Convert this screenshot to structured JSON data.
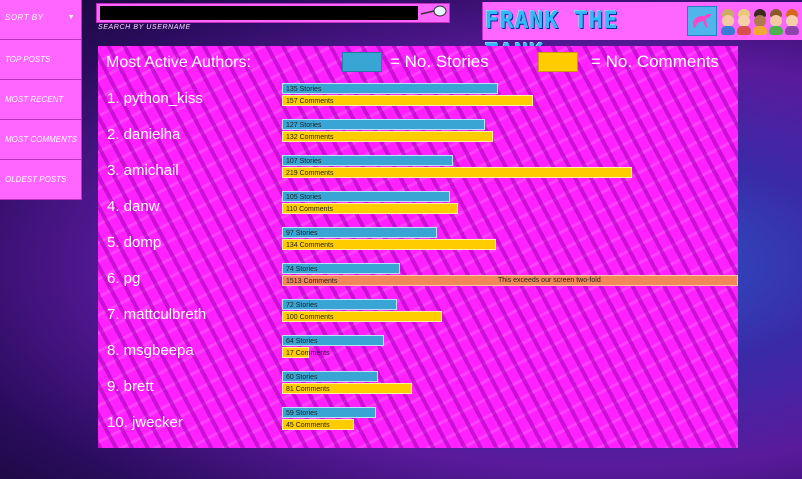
{
  "header": {
    "sort_by_label": "SORT BY",
    "search_placeholder": "",
    "search_caption": "SEARCH BY USERNAME",
    "logo_text": "FRANK THE TANK"
  },
  "menu": [
    {
      "label": "TOP POSTS"
    },
    {
      "label": "MOST RECENT"
    },
    {
      "label": "MOST COMMENTS"
    },
    {
      "label": "OLDEST POSTS"
    }
  ],
  "panel": {
    "title": "Most Active Authors:",
    "legend_stories": "= No. Stories",
    "legend_comments": "= No. Comments",
    "colors": {
      "stories": "#39a5d4",
      "comments": "#ffcc00",
      "exceeds": "#f2875a"
    }
  },
  "chart_data": {
    "type": "bar",
    "title": "Most Active Authors:",
    "categories": [
      "1. python_kiss",
      "2. danielha",
      "3. amichail",
      "4. danw",
      "5. domp",
      "6. pg",
      "7. mattculbreth",
      "8. msgbeepa",
      "9. brett",
      "10. jwecker"
    ],
    "series": [
      {
        "name": "No. Stories",
        "values": [
          135,
          127,
          107,
          105,
          97,
          74,
          72,
          64,
          60,
          59
        ],
        "labels": [
          "135 Stories",
          "127 Stories",
          "107 Stories",
          "105 Stories",
          "97 Stories",
          "74 Stories",
          "72 Stories",
          "64 Stories",
          "60 Stories",
          "59 Stories"
        ]
      },
      {
        "name": "No. Comments",
        "values": [
          157,
          132,
          219,
          110,
          134,
          1513,
          100,
          17,
          81,
          45
        ],
        "labels": [
          "157 Comments",
          "132 Comments",
          "219 Comments",
          "110 Comments",
          "134 Comments",
          "1513 Comments",
          "100 Comments",
          "17 Comments",
          "81 Comments",
          "45 Comments"
        ]
      }
    ],
    "overflow_note": "This exceeds our screen two-fold"
  }
}
